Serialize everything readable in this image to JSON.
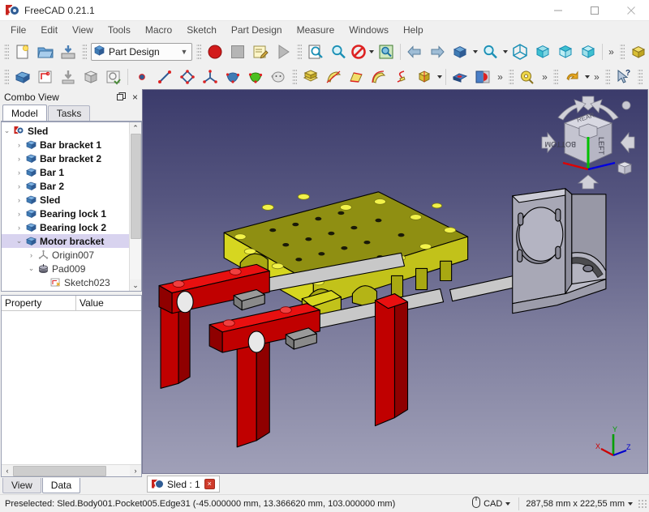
{
  "window": {
    "title": "FreeCAD 0.21.1",
    "app_icon": "freecad-icon",
    "minimize": "–",
    "maximize": "□",
    "close": "×"
  },
  "menubar": {
    "items": [
      {
        "label": "File"
      },
      {
        "label": "Edit"
      },
      {
        "label": "View"
      },
      {
        "label": "Tools"
      },
      {
        "label": "Macro"
      },
      {
        "label": "Sketch"
      },
      {
        "label": "Part Design"
      },
      {
        "label": "Measure"
      },
      {
        "label": "Windows"
      },
      {
        "label": "Help"
      }
    ]
  },
  "toolbars": {
    "workbench": {
      "selected": "Part Design",
      "arrow": "▼"
    },
    "row1": {
      "file_group": [
        "new-document-icon",
        "open-document-icon",
        "save-document-icon"
      ],
      "macro_group": [
        "macro-record-icon",
        "macro-stop-icon",
        "macro-edit-icon",
        "macro-execute-icon"
      ],
      "view_group": [
        "fit-all-icon",
        "fit-selection-icon",
        "draw-style-icon",
        "axonometric-icon",
        "view-previous-icon",
        "view-next-icon",
        "std-views-icon",
        "zoom-icon",
        "isometric-view-icon",
        "front-view-icon",
        "top-view-icon",
        "right-view-icon"
      ],
      "overflow": "»",
      "part_group": [
        "part-box-icon"
      ],
      "overflow2": "»"
    },
    "row2": {
      "body_group": [
        "create-body-icon",
        "create-sketch-icon",
        "attach-sketch-icon",
        "validate-sketch-icon",
        "map-sketch-icon"
      ],
      "datum_group": [
        "datum-point-icon",
        "datum-line-icon",
        "datum-plane-icon",
        "datum-coordinate-icon",
        "shape-binder-icon",
        "sub-shape-binder-icon",
        "clone-icon"
      ],
      "feature_group": [
        "pad-icon",
        "revolution-icon",
        "additive-loft-icon",
        "additive-pipe-icon",
        "additive-helix-icon",
        "additive-primitive-icon"
      ],
      "boolean_group": [
        "pocket-icon",
        "boolean-icon"
      ],
      "overflow": "»",
      "measure_group": [
        "measure-icon"
      ],
      "overflow2": "»",
      "undo_group": [
        "undo-icon"
      ],
      "overflow3": "»",
      "help_group": [
        "whats-this-icon"
      ],
      "close_group": [
        "close-document-icon"
      ],
      "overflow4": "»"
    }
  },
  "combo_view": {
    "title": "Combo View",
    "float_btn": "❐",
    "close_btn": "×",
    "tabs": [
      {
        "label": "Model",
        "active": true
      },
      {
        "label": "Tasks",
        "active": false
      }
    ],
    "tree": [
      {
        "label": "Sled",
        "depth": 0,
        "arrow": "⌄",
        "icon": "document-icon",
        "bold": true,
        "selected": false
      },
      {
        "label": "Bar bracket 1",
        "depth": 1,
        "arrow": "›",
        "icon": "body-icon",
        "bold": true,
        "selected": false
      },
      {
        "label": "Bar bracket 2",
        "depth": 1,
        "arrow": "›",
        "icon": "body-icon",
        "bold": true,
        "selected": false
      },
      {
        "label": "Bar 1",
        "depth": 1,
        "arrow": "›",
        "icon": "body-icon",
        "bold": true,
        "selected": false
      },
      {
        "label": "Bar 2",
        "depth": 1,
        "arrow": "›",
        "icon": "body-icon",
        "bold": true,
        "selected": false
      },
      {
        "label": "Sled",
        "depth": 1,
        "arrow": "›",
        "icon": "body-icon",
        "bold": true,
        "selected": false
      },
      {
        "label": "Bearing lock 1",
        "depth": 1,
        "arrow": "›",
        "icon": "body-icon",
        "bold": true,
        "selected": false
      },
      {
        "label": "Bearing lock 2",
        "depth": 1,
        "arrow": "›",
        "icon": "body-icon",
        "bold": true,
        "selected": false
      },
      {
        "label": "Motor bracket",
        "depth": 1,
        "arrow": "⌄",
        "icon": "body-icon",
        "bold": true,
        "selected": true
      },
      {
        "label": "Origin007",
        "depth": 2,
        "arrow": "›",
        "icon": "origin-icon",
        "bold": false,
        "selected": false
      },
      {
        "label": "Pad009",
        "depth": 2,
        "arrow": "⌄",
        "icon": "pad-feature-icon",
        "bold": false,
        "selected": false
      },
      {
        "label": "Sketch023",
        "depth": 3,
        "arrow": "",
        "icon": "sketch-icon",
        "bold": false,
        "selected": false
      }
    ],
    "scroll_up": "⌃",
    "scroll_down": "⌄"
  },
  "property_editor": {
    "columns": [
      "Property",
      "Value"
    ],
    "rows": [],
    "scroll_left": "‹",
    "scroll_right": "›",
    "tabs": [
      {
        "label": "View",
        "active": false
      },
      {
        "label": "Data",
        "active": true
      }
    ]
  },
  "view3d": {
    "nav_cube": {
      "faces": [
        "BOTTOM",
        "LEFT",
        "REAR"
      ],
      "arrow_up": "up-arrow",
      "arrow_down": "down-arrow",
      "arrow_left": "left-arrow",
      "arrow_right": "right-arrow",
      "rotate_left": "rotate-ccw-arrow",
      "rotate_right": "rotate-cw-arrow",
      "home_dot": "home-dot",
      "corner_cube": "corner-cube"
    },
    "axis_labels": {
      "x": "X",
      "y": "Y",
      "z": "Z"
    },
    "axis_colors": {
      "x": "#cc0000",
      "y": "#00a000",
      "z": "#0000cc"
    },
    "model_colors": {
      "plate": "#d8d81f",
      "plate_top": "#9a9a14",
      "legs": "#e00000",
      "legs_dark": "#a10000",
      "rods": "#cccccc",
      "bracket": "#b0b0bc",
      "outline": "#000000"
    },
    "background": {
      "top": "#3b3b6b",
      "bottom": "#a0a0b8"
    }
  },
  "document_tabs": [
    {
      "label": "Sled : 1",
      "icon": "freecad-icon",
      "close": "×",
      "active": true
    }
  ],
  "statusbar": {
    "message": "Preselected: Sled.Body001.Pocket005.Edge31 (-45.000000 mm, 13.366620 mm, 103.000000 mm)",
    "nav_style": "CAD",
    "nav_icon": "mouse-icon",
    "nav_caret": "▼",
    "dimensions": "287,58 mm x 222,55 mm",
    "dim_caret": "▼"
  }
}
